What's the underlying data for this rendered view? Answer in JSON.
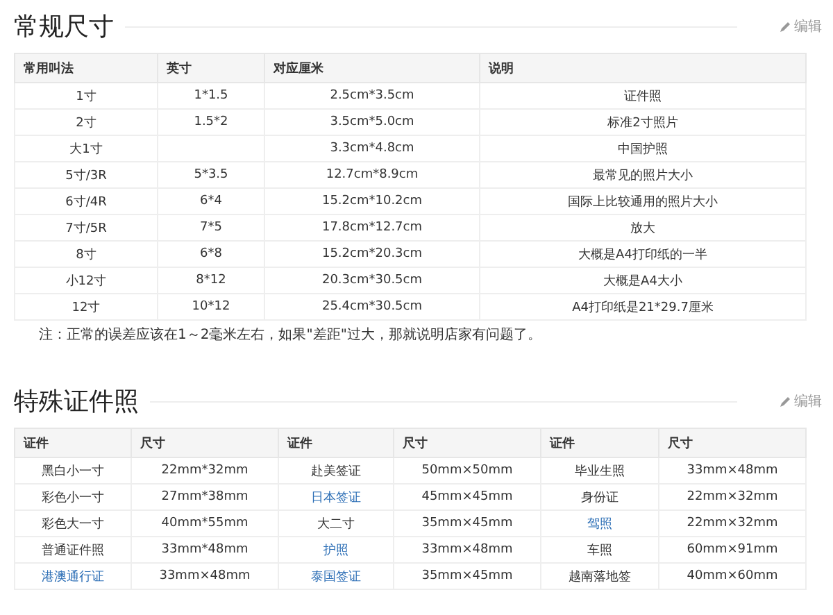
{
  "sections": [
    {
      "title": "常规尺寸",
      "edit": "编辑",
      "columns": [
        "常用叫法",
        "英寸",
        "对应厘米",
        "说明"
      ],
      "rows": [
        [
          {
            "text": "1寸",
            "link": false
          },
          {
            "text": "1*1.5",
            "link": false
          },
          {
            "text": "2.5cm*3.5cm",
            "link": false
          },
          {
            "text": "证件照",
            "link": false
          }
        ],
        [
          {
            "text": "2寸",
            "link": false
          },
          {
            "text": "1.5*2",
            "link": false
          },
          {
            "text": "3.5cm*5.0cm",
            "link": false
          },
          {
            "text": "标准2寸照片",
            "link": false
          }
        ],
        [
          {
            "text": "大1寸",
            "link": false
          },
          null,
          {
            "text": "3.3cm*4.8cm",
            "link": false
          },
          {
            "text": "中国护照",
            "link": false
          }
        ],
        [
          {
            "text": "5寸/3R",
            "link": false
          },
          {
            "text": "5*3.5",
            "link": false
          },
          {
            "text": "12.7cm*8.9cm",
            "link": false
          },
          {
            "text": "最常见的照片大小",
            "link": false
          }
        ],
        [
          {
            "text": "6寸/4R",
            "link": false
          },
          {
            "text": "6*4",
            "link": false
          },
          {
            "text": "15.2cm*10.2cm",
            "link": false
          },
          {
            "text": "国际上比较通用的照片大小",
            "link": false
          }
        ],
        [
          {
            "text": "7寸/5R",
            "link": false
          },
          {
            "text": "7*5",
            "link": false
          },
          {
            "text": "17.8cm*12.7cm",
            "link": false
          },
          {
            "text": "放大",
            "link": false
          }
        ],
        [
          {
            "text": "8寸",
            "link": false
          },
          {
            "text": "6*8",
            "link": false
          },
          {
            "text": "15.2cm*20.3cm",
            "link": false
          },
          {
            "text": "大概是A4打印纸的一半",
            "link": false
          }
        ],
        [
          {
            "text": "小12寸",
            "link": false
          },
          {
            "text": "8*12",
            "link": false
          },
          {
            "text": "20.3cm*30.5cm",
            "link": false
          },
          {
            "text": "大概是A4大小",
            "link": false
          }
        ],
        [
          {
            "text": "12寸",
            "link": false
          },
          {
            "text": "10*12",
            "link": false
          },
          {
            "text": "25.4cm*30.5cm",
            "link": false
          },
          {
            "text": "A4打印纸是21*29.7厘米",
            "link": false
          }
        ]
      ],
      "note": "注：正常的误差应该在1～2毫米左右，如果\"差距\"过大，那就说明店家有问题了。"
    },
    {
      "title": "特殊证件照",
      "edit": "编辑",
      "columns": [
        "证件",
        "尺寸",
        "证件",
        "尺寸",
        "证件",
        "尺寸"
      ],
      "rows": [
        [
          {
            "text": "黑白小一寸",
            "link": false
          },
          {
            "text": "22mm*32mm",
            "link": false
          },
          {
            "text": "赴美签证",
            "link": false
          },
          {
            "text": "50mm×50mm",
            "link": false
          },
          {
            "text": "毕业生照",
            "link": false
          },
          {
            "text": "33mm×48mm",
            "link": false
          }
        ],
        [
          {
            "text": "彩色小一寸",
            "link": false
          },
          {
            "text": "27mm*38mm",
            "link": false
          },
          {
            "text": "日本签证",
            "link": true
          },
          {
            "text": "45mm×45mm",
            "link": false
          },
          {
            "text": "身份证",
            "link": false
          },
          {
            "text": "22mm×32mm",
            "link": false
          }
        ],
        [
          {
            "text": "彩色大一寸",
            "link": false
          },
          {
            "text": "40mm*55mm",
            "link": false
          },
          {
            "text": "大二寸",
            "link": false
          },
          {
            "text": "35mm×45mm",
            "link": false
          },
          {
            "text": "驾照",
            "link": true
          },
          {
            "text": "22mm×32mm",
            "link": false
          }
        ],
        [
          {
            "text": "普通证件照",
            "link": false
          },
          {
            "text": "33mm*48mm",
            "link": false
          },
          {
            "text": "护照",
            "link": true
          },
          {
            "text": "33mm×48mm",
            "link": false
          },
          {
            "text": "车照",
            "link": false
          },
          {
            "text": "60mm×91mm",
            "link": false
          }
        ],
        [
          {
            "text": "港澳通行证",
            "link": true
          },
          {
            "text": "33mm×48mm",
            "link": false
          },
          {
            "text": "泰国签证",
            "link": true
          },
          {
            "text": "35mm×45mm",
            "link": false
          },
          {
            "text": "越南落地签",
            "link": false
          },
          {
            "text": "40mm×60mm",
            "link": false
          }
        ]
      ]
    }
  ]
}
